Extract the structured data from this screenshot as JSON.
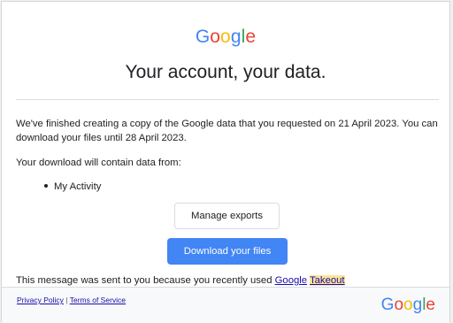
{
  "header": {
    "logo_letters": [
      {
        "char": "G",
        "color": "#4285f4"
      },
      {
        "char": "o",
        "color": "#ea4335"
      },
      {
        "char": "o",
        "color": "#fbbc05"
      },
      {
        "char": "g",
        "color": "#4285f4"
      },
      {
        "char": "l",
        "color": "#34a853"
      },
      {
        "char": "e",
        "color": "#ea4335"
      }
    ],
    "headline": "Your account, your data."
  },
  "body": {
    "paragraph1": "We've finished creating a copy of the Google data that you requested on 21 April 2023. You can download your files until 28 April 2023.",
    "paragraph2": "Your download will contain data from:",
    "items": [
      "My Activity"
    ]
  },
  "buttons": {
    "manage_exports": "Manage exports",
    "download_files": "Download your files"
  },
  "notice": {
    "text": "This message was sent to you because you recently used",
    "link_google": "Google",
    "link_takeout": "Takeout"
  },
  "footer": {
    "privacy_policy": "Privacy Policy",
    "separator": "|",
    "terms_of_service": "Terms of Service"
  },
  "colors": {
    "primary_button": "#4285f4",
    "link": "#1a0dab",
    "highlight": "#fce39a"
  }
}
